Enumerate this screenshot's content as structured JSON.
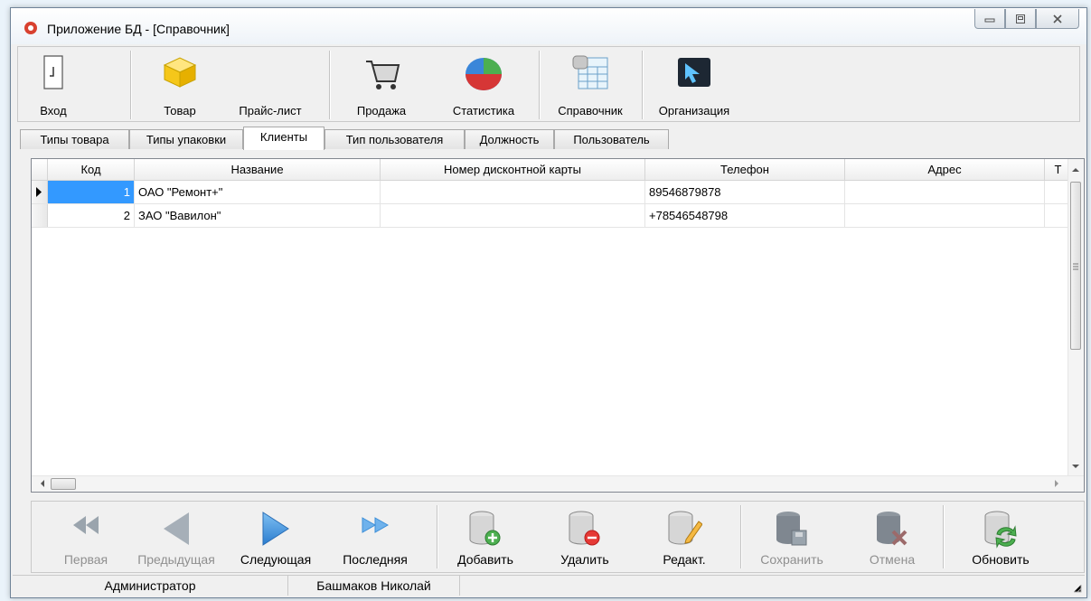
{
  "window": {
    "title": "Приложение БД - [Справочник]"
  },
  "toolbar": {
    "login_label": "Вход",
    "goods_label": "Товар",
    "pricelist_label": "Прайс-лист",
    "sale_label": "Продажа",
    "stats_label": "Статистика",
    "reference_label": "Справочник",
    "org_label": "Организация"
  },
  "tabs": [
    {
      "label": "Типы товара"
    },
    {
      "label": "Типы упаковки"
    },
    {
      "label": "Клиенты",
      "active": true
    },
    {
      "label": "Тип пользователя"
    },
    {
      "label": "Должность"
    },
    {
      "label": "Пользователь"
    }
  ],
  "grid": {
    "columns": [
      "Код",
      "Название",
      "Номер дисконтной карты",
      "Телефон",
      "Адрес",
      "Т"
    ],
    "rows": [
      {
        "code": "1",
        "name": "ОАО \"Ремонт+\"",
        "card": "",
        "phone": "89546879878",
        "address": ""
      },
      {
        "code": "2",
        "name": "ЗАО \"Вавилон\"",
        "card": "",
        "phone": "+78546548798",
        "address": ""
      }
    ]
  },
  "navbar": {
    "first_label": "Первая",
    "prev_label": "Предыдущая",
    "next_label": "Следующая",
    "last_label": "Последняя",
    "add_label": "Добавить",
    "delete_label": "Удалить",
    "edit_label": "Редакт.",
    "save_label": "Сохранить",
    "cancel_label": "Отмена",
    "refresh_label": "Обновить"
  },
  "status": {
    "role": "Администратор",
    "user": "Башмаков Николай"
  },
  "colors": {
    "selection": "#3399ff",
    "nav_blue": "#3d8fd8",
    "disabled_gray": "#9aa4ad"
  }
}
